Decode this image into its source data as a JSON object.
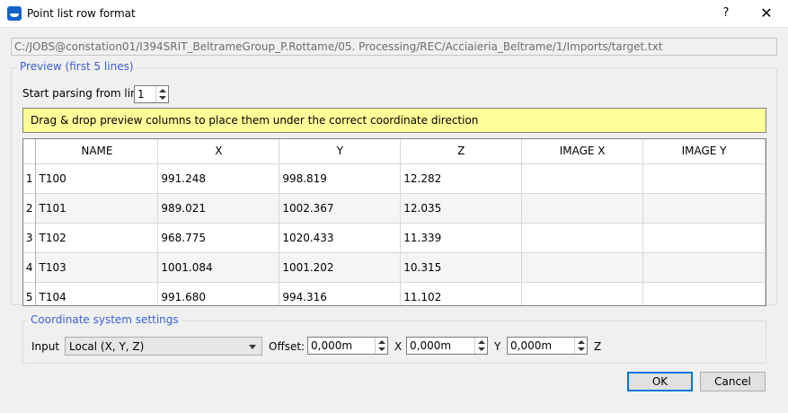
{
  "window": {
    "title": "Point list row format",
    "help_label": "?",
    "close_label": "✕"
  },
  "path": "C:/JOBS@constation01/I394SRIT_BeltrameGroup_P.Rottame/05. Processing/REC/Acciaieria_Beltrame/1/Imports/target.txt",
  "preview": {
    "group_title": "Preview (first 5 lines)",
    "start_label": "Start parsing from line",
    "start_value": "1",
    "banner": "Drag & drop preview columns to place them under the correct coordinate direction",
    "banner_color": "#ffff99"
  },
  "table": {
    "columns": [
      "NAME",
      "X",
      "Y",
      "Z",
      "IMAGE X",
      "IMAGE Y"
    ],
    "rows": [
      {
        "num": "1",
        "cells": [
          "T100",
          "991.248",
          "998.819",
          "12.282",
          "",
          ""
        ]
      },
      {
        "num": "2",
        "cells": [
          "T101",
          "989.021",
          "1002.367",
          "12.035",
          "",
          ""
        ]
      },
      {
        "num": "3",
        "cells": [
          "T102",
          "968.775",
          "1020.433",
          "11.339",
          "",
          ""
        ]
      },
      {
        "num": "4",
        "cells": [
          "T103",
          "1001.084",
          "1001.202",
          "10.315",
          "",
          ""
        ]
      },
      {
        "num": "5",
        "cells": [
          "T104",
          "991.680",
          "994.316",
          "11.102",
          "",
          ""
        ]
      }
    ]
  },
  "coords": {
    "group_title": "Coordinate system settings",
    "input_label": "Input",
    "input_value": "Local (X, Y, Z)",
    "offset_label": "Offset:",
    "offset_x": "0,000m",
    "x_label": "X",
    "offset_y": "0,000m",
    "y_label": "Y",
    "offset_z": "0,000m",
    "z_label": "Z"
  },
  "buttons": {
    "ok": "OK",
    "cancel": "Cancel"
  },
  "colors": {
    "accent": "#3b5fcf",
    "focus": "#0078d7"
  }
}
